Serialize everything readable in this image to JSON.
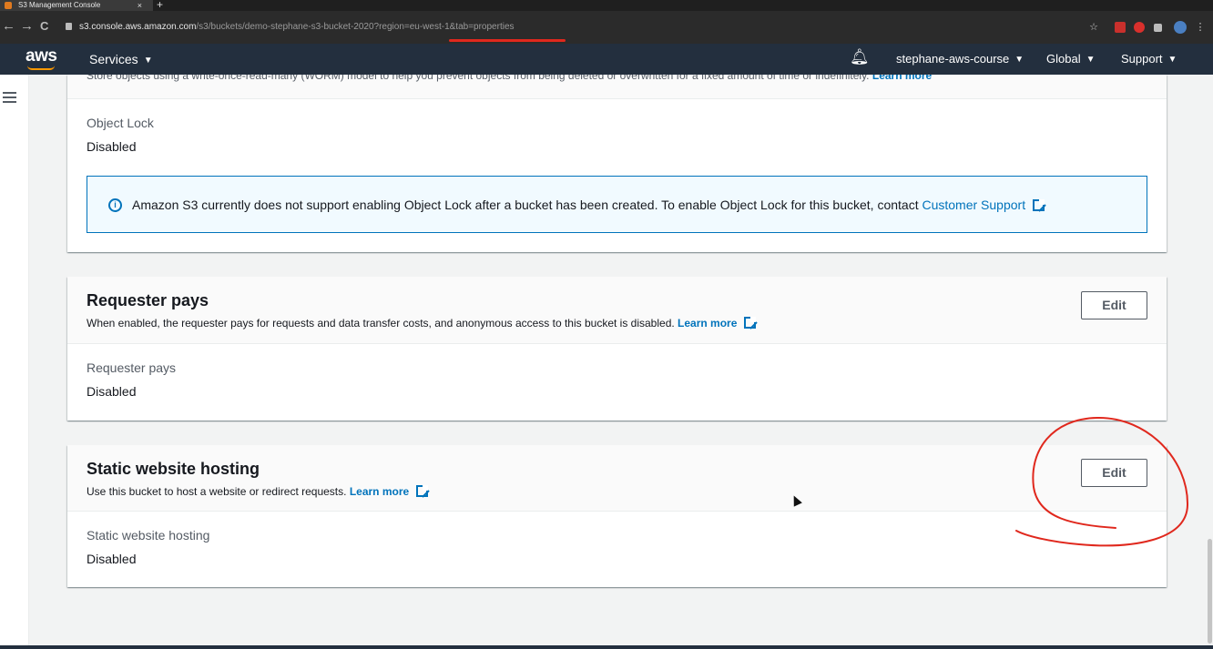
{
  "browser": {
    "tab_title": "S3 Management Console",
    "tab_close": "×",
    "new_tab": "+",
    "back": "←",
    "forward": "→",
    "reload": "C",
    "url_host": "s3.console.aws.amazon.com",
    "url_path": "/s3/buckets/demo-stephane-s3-bucket-2020?region=eu-west-1&tab=properties",
    "star": "☆",
    "menu": "⋮"
  },
  "header": {
    "logo": "aws",
    "services": "Services",
    "account": "stephane-aws-course",
    "region": "Global",
    "support": "Support"
  },
  "object_lock": {
    "cutoff_desc": "Store objects using a write-once-read-many (WORM) model to help you prevent objects from being deleted or overwritten for a fixed amount of time or indefinitely.",
    "cutoff_link": "Learn more",
    "field_label": "Object Lock",
    "field_value": "Disabled",
    "info_text": "Amazon S3 currently does not support enabling Object Lock after a bucket has been created. To enable Object Lock for this bucket, contact",
    "info_link": "Customer Support",
    "info_icon": "i"
  },
  "requester_pays": {
    "title": "Requester pays",
    "desc": "When enabled, the requester pays for requests and data transfer costs, and anonymous access to this bucket is disabled.",
    "link": "Learn more",
    "edit": "Edit",
    "field_label": "Requester pays",
    "field_value": "Disabled"
  },
  "static_hosting": {
    "title": "Static website hosting",
    "desc": "Use this bucket to host a website or redirect requests.",
    "link": "Learn more",
    "edit": "Edit",
    "field_label": "Static website hosting",
    "field_value": "Disabled"
  },
  "colors": {
    "header_bg": "#232f3e",
    "link": "#0073bb",
    "annotation": "#e0281d",
    "aws_orange": "#ff9900"
  }
}
